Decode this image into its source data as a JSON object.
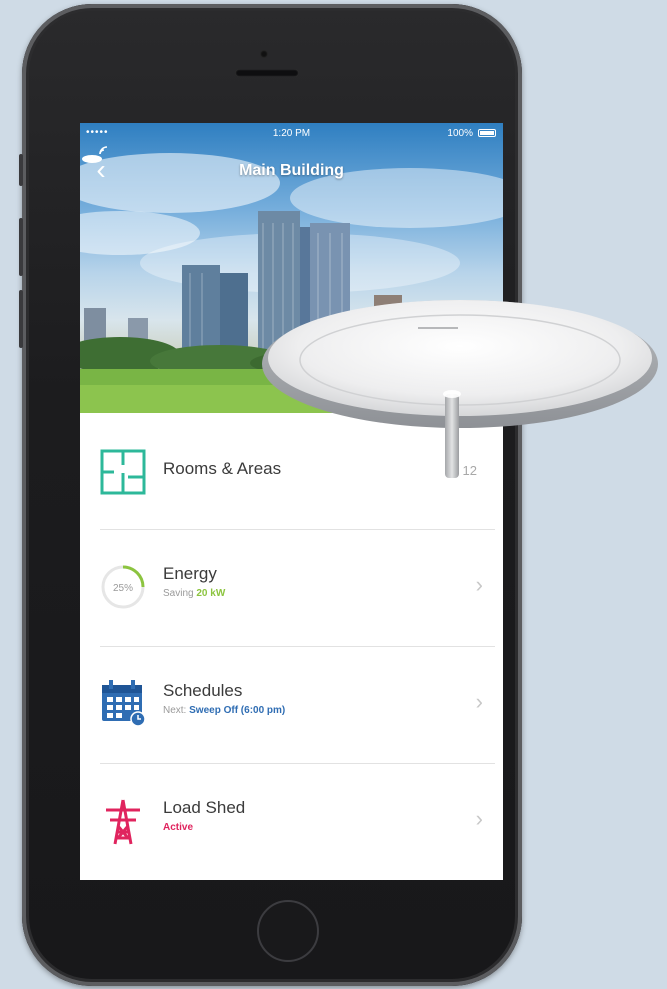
{
  "status_bar": {
    "signal": "•••••",
    "time": "1:20 PM",
    "battery": "100%"
  },
  "nav": {
    "back_icon": "chevron-left-icon",
    "title": "Main Building",
    "action_icon": "wireless-sensor-icon"
  },
  "menu": [
    {
      "title": "Rooms & Areas",
      "subtitle_prefix": "",
      "subtitle_value": "",
      "count": "12",
      "icon": "floorplan-icon"
    },
    {
      "title": "Energy",
      "subtitle_prefix": "Saving",
      "subtitle_value": "20 kW",
      "gauge_label": "25%",
      "icon": "energy-gauge-icon"
    },
    {
      "title": "Schedules",
      "subtitle_prefix": "Next:",
      "subtitle_value": "Sweep Off (6:00 pm)",
      "icon": "calendar-icon"
    },
    {
      "title": "Load Shed",
      "subtitle_prefix": "",
      "subtitle_value": "Active",
      "icon": "power-tower-icon"
    }
  ],
  "colors": {
    "rooms_teal": "#2db89a",
    "energy_green": "#8cc43f",
    "schedule_blue": "#2f6db3",
    "loadshed_red": "#e0245e"
  }
}
